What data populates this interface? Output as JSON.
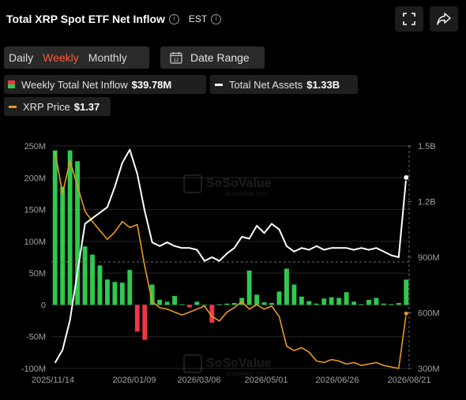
{
  "header": {
    "title": "Total XRP Spot ETF Net Inflow",
    "timezone": "EST"
  },
  "periods": {
    "daily": "Daily",
    "weekly": "Weekly",
    "monthly": "Monthly",
    "active": "Weekly"
  },
  "date_range": {
    "label": "Date Range",
    "icon_day": "12"
  },
  "legend": {
    "inflow": {
      "label": "Weekly Total Net Inflow",
      "value": "$39.78M"
    },
    "assets": {
      "label": "Total Net Assets",
      "value": "$1.33B"
    },
    "price": {
      "label": "XRP Price",
      "value": "$1.37"
    }
  },
  "watermark": {
    "brand": "SoSoValue",
    "sub": "sosovalue.com"
  },
  "colors": {
    "positive": "#2ec94e",
    "negative": "#f23645",
    "assets_line": "#ffffff",
    "price_line": "#e89a1f",
    "accent": "#ff5a36"
  },
  "icons": {
    "fullscreen": "fullscreen-icon",
    "share": "share-icon",
    "calendar": "calendar-icon",
    "info": "info-icon"
  },
  "chart_data": {
    "type": "bar",
    "y_left": {
      "ticks": [
        "250M",
        "200M",
        "150M",
        "100M",
        "50M",
        "0",
        "-50M",
        "-100M"
      ],
      "range": [
        -100,
        250
      ],
      "unit": "M USD"
    },
    "y_right": {
      "ticks": [
        "1.5B",
        "1.2B",
        "900M",
        "600M",
        "300M"
      ],
      "range": [
        300,
        1500
      ],
      "unit": "M USD"
    },
    "x_ticks": [
      "2025/11/14",
      "2026/01/09",
      "2026/03/06",
      "2026/05/01",
      "2026/06/26",
      "2026/08/21"
    ],
    "grid": true,
    "legend_position": "top",
    "series": [
      {
        "name": "Weekly Total Net Inflow",
        "type": "bar",
        "axis": "left",
        "values": [
          243,
          186,
          243,
          226,
          92,
          79,
          62,
          40,
          36,
          35,
          55,
          -42,
          -55,
          32,
          8,
          5,
          14,
          1,
          -4,
          5,
          0,
          -28,
          1,
          2,
          3,
          11,
          54,
          16,
          4,
          3,
          21,
          57,
          32,
          13,
          6,
          2,
          10,
          12,
          11,
          20,
          5,
          1,
          8,
          11,
          2,
          1,
          3,
          39.78
        ]
      },
      {
        "name": "Total Net Assets",
        "type": "line",
        "axis": "right",
        "values": [
          330,
          400,
          560,
          820,
          1080,
          1110,
          1140,
          1170,
          1280,
          1410,
          1480,
          1350,
          1150,
          980,
          960,
          980,
          960,
          950,
          950,
          940,
          880,
          900,
          880,
          920,
          950,
          1010,
          1000,
          1070,
          1030,
          1080,
          1050,
          960,
          930,
          950,
          940,
          960,
          940,
          950,
          950,
          950,
          940,
          950,
          940,
          950,
          930,
          910,
          900,
          1330
        ]
      },
      {
        "name": "XRP Price",
        "type": "line",
        "axis": "right",
        "values": [
          2.46,
          2.18,
          2.4,
          2.23,
          2.06,
          1.99,
          1.93,
          1.87,
          1.92,
          1.99,
          1.95,
          1.97,
          1.69,
          1.45,
          1.41,
          1.4,
          1.38,
          1.36,
          1.38,
          1.4,
          1.42,
          1.35,
          1.32,
          1.38,
          1.41,
          1.45,
          1.4,
          1.43,
          1.4,
          1.42,
          1.35,
          1.15,
          1.12,
          1.14,
          1.11,
          1.05,
          1.04,
          1.06,
          1.05,
          1.03,
          1.04,
          1.02,
          1.03,
          1.04,
          1.02,
          1.01,
          1.0,
          1.37
        ]
      }
    ]
  }
}
